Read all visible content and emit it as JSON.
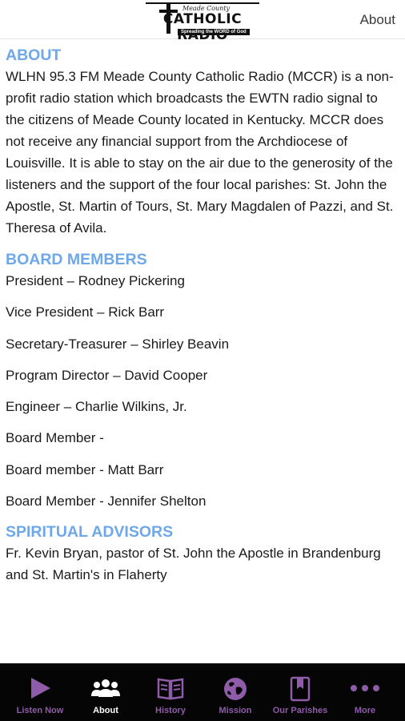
{
  "header": {
    "logo": {
      "county": "Meade County",
      "title": "CATHOLIC RADIO",
      "tagline": "Spreading the WORD of God"
    },
    "about_link": "About"
  },
  "about": {
    "heading": "ABOUT",
    "text": "WLHN 95.3 FM Meade County Catholic Radio (MCCR) is a non-profit radio station which broadcasts the EWTN radio signal to the citizens of Meade County located in Kentucky. MCCR does not receive any financial support from the Archdiocese of Louisville. It is able to stay on the air due to the generosity of the listeners and the support of the four local parishes: St. John the Apostle, St. Martin of Tours, St. Mary Magdalen of Pazzi, and St. Theresa of Avila."
  },
  "board": {
    "heading": "BOARD MEMBERS",
    "members": [
      "President – Rodney Pickering",
      "Vice President – Rick Barr",
      "Secretary-Treasurer – Shirley Beavin",
      "Program Director – David Cooper",
      "Engineer – Charlie Wilkins, Jr.",
      "Board Member -",
      "Board member - Matt Barr",
      "Board Member - Jennifer Shelton"
    ]
  },
  "spiritual": {
    "heading": "SPIRITUAL ADVISORS",
    "text": "Fr. Kevin Bryan, pastor of St. John the Apostle in Brandenburg and St. Martin's in Flaherty"
  },
  "tabs": [
    {
      "label": "Listen Now",
      "icon": "play-icon"
    },
    {
      "label": "About",
      "icon": "people-icon"
    },
    {
      "label": "History",
      "icon": "book-icon"
    },
    {
      "label": "Mission",
      "icon": "globe-icon"
    },
    {
      "label": "Our Parishes",
      "icon": "bookmark-icon"
    },
    {
      "label": "More",
      "icon": "more-dots-icon"
    }
  ],
  "colors": {
    "heading": "#6fa8e8",
    "tab_bar": "#050505",
    "tab_icon": "#8e5ca8",
    "tab_active": "#ffffff"
  }
}
